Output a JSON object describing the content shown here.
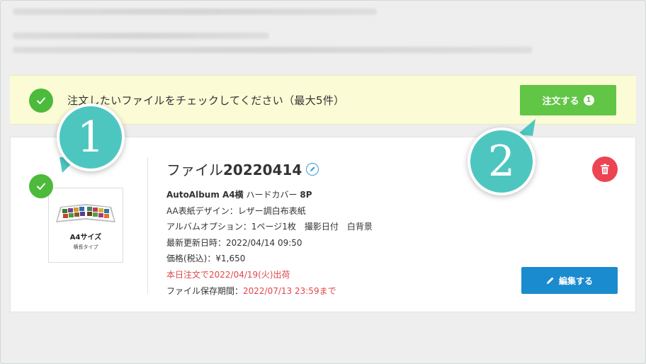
{
  "notice": {
    "text": "注文したいファイルをチェックしてください（最大5件）",
    "order_label": "注文する",
    "order_count": "1"
  },
  "item": {
    "title_prefix": "ファイル",
    "title_number": "20220414",
    "thumbnail": {
      "size": "A4サイズ",
      "type": "横長タイプ"
    },
    "product_model": "AutoAlbum A4横",
    "product_cover": "ハードカバー",
    "product_pages": "8P",
    "cover_design": "AA表紙デザイン：レザー調白布表紙",
    "options": "アルバムオプション：1ページ1枚　撮影日付　白背景",
    "updated": "最新更新日時：2022/04/14 09:50",
    "price": "価格(税込)：¥1,650",
    "ship_notice": "本日注文で2022/04/19(火)出荷",
    "storage_label": "ファイル保存期間：",
    "storage_value": "2022/07/13 23:59まで",
    "edit_label": "編集する"
  },
  "callouts": {
    "one": "1",
    "two": "2"
  },
  "colors": {
    "accent_green": "#61c546",
    "check_green": "#4cba3a",
    "edit_blue": "#1b8bcf",
    "delete_red": "#ec4452",
    "callout_teal": "#4ec6c0",
    "notice_bg": "#fbfbd6",
    "warning_red": "#e0474c"
  },
  "icons": [
    "check-icon",
    "pencil-icon",
    "trash-icon",
    "album-thumbnail"
  ]
}
